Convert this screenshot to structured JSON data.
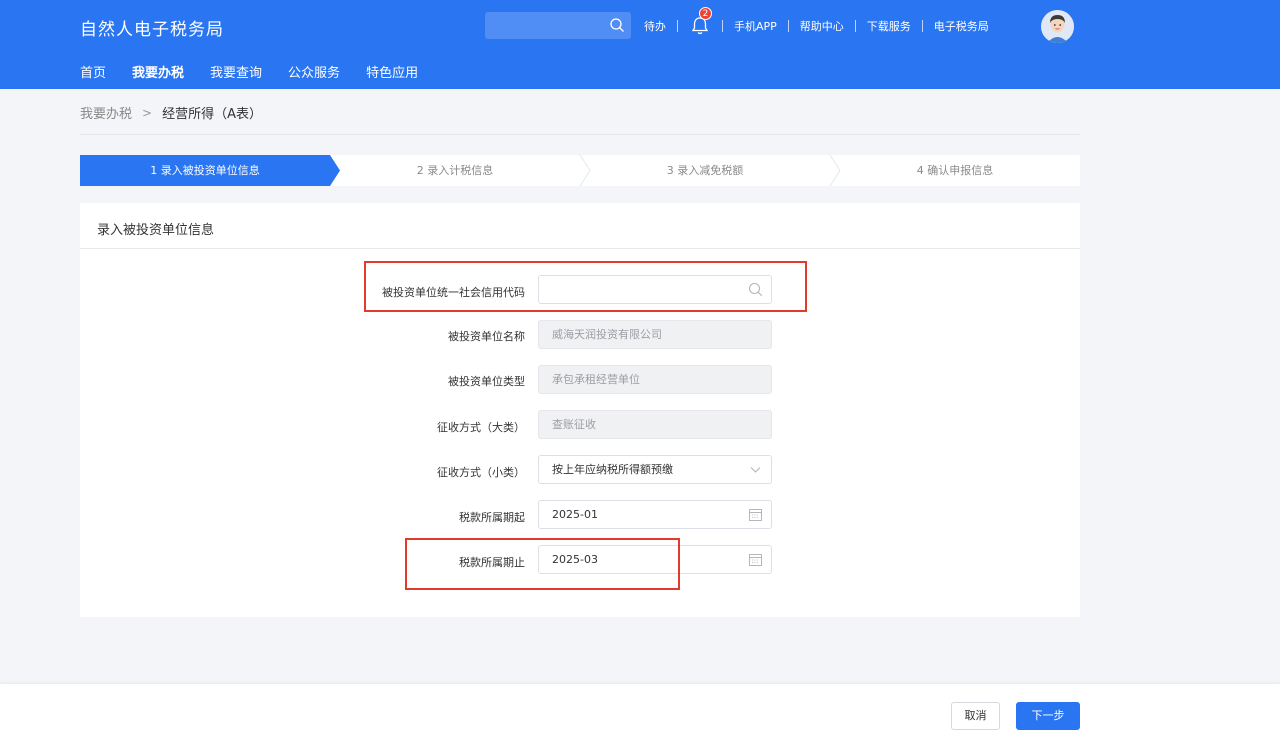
{
  "header": {
    "brand": "自然人电子税务局",
    "search_placeholder": "",
    "links": {
      "todo": "待办",
      "notif_count": "2",
      "mobile_app": "手机APP",
      "help": "帮助中心",
      "download": "下载服务",
      "etax": "电子税务局"
    },
    "nav": [
      "首页",
      "我要办税",
      "我要查询",
      "公众服务",
      "特色应用"
    ],
    "active_nav": "我要办税"
  },
  "breadcrumb": {
    "parent": "我要办税",
    "separator": ">",
    "current": "经营所得（A表）"
  },
  "steps": [
    {
      "label": "1  录入被投资单位信息",
      "active": true
    },
    {
      "label": "2  录入计税信息",
      "active": false
    },
    {
      "label": "3  录入减免税额",
      "active": false
    },
    {
      "label": "4  确认申报信息",
      "active": false
    }
  ],
  "form": {
    "title": "录入被投资单位信息",
    "credit_code": {
      "label": "被投资单位统一社会信用代码",
      "value": ""
    },
    "company_name": {
      "label": "被投资单位名称",
      "value": "威海天润投资有限公司"
    },
    "company_type": {
      "label": "被投资单位类型",
      "value": "承包承租经营单位"
    },
    "collect_major": {
      "label": "征收方式（大类）",
      "value": "查账征收"
    },
    "collect_minor": {
      "label": "征收方式（小类）",
      "value": "按上年应纳税所得额预缴"
    },
    "period_start": {
      "label": "税款所属期起",
      "value": "2025-01"
    },
    "period_end": {
      "label": "税款所属期止",
      "value": "2025-03"
    }
  },
  "footer": {
    "cancel": "取消",
    "next": "下一步"
  },
  "colors": {
    "primary": "#2a75f2",
    "highlight": "#e23b2b",
    "badge": "#f04134"
  }
}
